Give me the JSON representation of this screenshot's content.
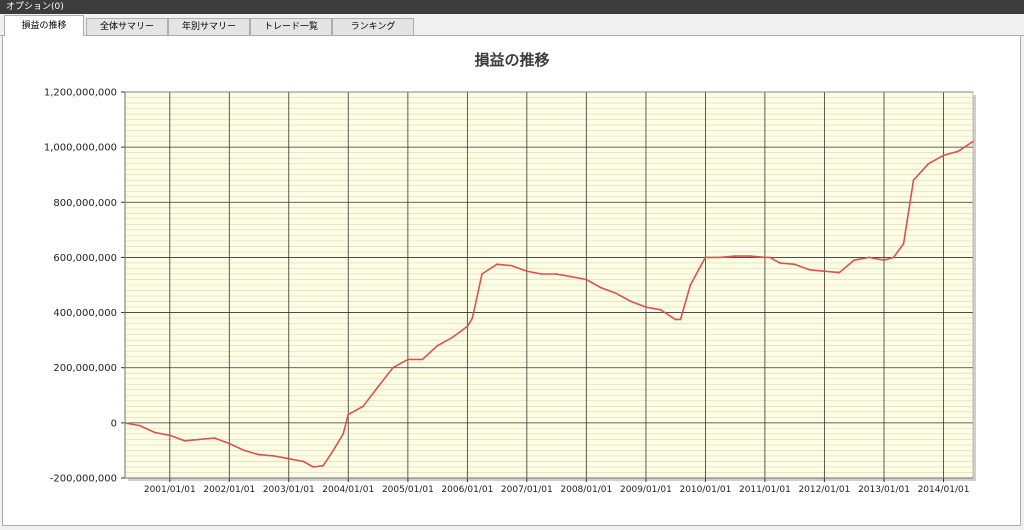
{
  "menu": {
    "options_label": "オプション(0)"
  },
  "tabs": [
    {
      "label": "損益の推移",
      "active": true
    },
    {
      "label": "全体サマリー",
      "active": false
    },
    {
      "label": "年別サマリー",
      "active": false
    },
    {
      "label": "トレード一覧",
      "active": false
    },
    {
      "label": "ランキング",
      "active": false
    }
  ],
  "colors": {
    "plot_background": "#fdfde6",
    "line": "#d9534f",
    "major_grid": "#333333",
    "minor_grid": "#d8d8b0"
  },
  "chart_data": {
    "type": "line",
    "title": "損益の推移",
    "xlabel": "",
    "ylabel": "",
    "xlim": [
      "2000/04/01",
      "2014/07/01"
    ],
    "ylim": [
      -200000000,
      1200000000
    ],
    "x_tick_labels": [
      "2001/01/01",
      "2002/01/01",
      "2003/01/01",
      "2004/01/01",
      "2005/01/01",
      "2006/01/01",
      "2007/01/01",
      "2008/01/01",
      "2009/01/01",
      "2010/01/01",
      "2011/01/01",
      "2012/01/01",
      "2013/01/01",
      "2014/01/01"
    ],
    "y_tick_labels": [
      "1,200,000,000",
      "1,000,000,000",
      "800,000,000",
      "600,000,000",
      "400,000,000",
      "200,000,000",
      "0",
      "-200,000,000"
    ],
    "y_tick_values": [
      1200000000,
      1000000000,
      800000000,
      600000000,
      400000000,
      200000000,
      0,
      -200000000
    ],
    "grid": true,
    "series": [
      {
        "x": [
          "2000/04/01",
          "2000/07/01",
          "2000/10/01",
          "2001/01/01",
          "2001/04/01",
          "2001/07/01",
          "2001/10/01",
          "2002/01/01",
          "2002/04/01",
          "2002/07/01",
          "2002/10/01",
          "2003/01/01",
          "2003/04/01",
          "2003/06/01",
          "2003/08/01",
          "2003/10/01",
          "2003/12/01",
          "2004/01/01",
          "2004/04/01",
          "2004/07/01",
          "2004/10/01",
          "2005/01/01",
          "2005/04/01",
          "2005/07/01",
          "2005/10/01",
          "2006/01/01",
          "2006/02/01",
          "2006/04/01",
          "2006/07/01",
          "2006/10/01",
          "2007/01/01",
          "2007/04/01",
          "2007/07/01",
          "2007/10/01",
          "2008/01/01",
          "2008/04/01",
          "2008/07/01",
          "2008/10/01",
          "2009/01/01",
          "2009/04/01",
          "2009/07/01",
          "2009/08/01",
          "2009/10/01",
          "2010/01/01",
          "2010/04/01",
          "2010/07/01",
          "2010/10/01",
          "2011/01/01",
          "2011/02/01",
          "2011/04/01",
          "2011/07/01",
          "2011/10/01",
          "2012/01/01",
          "2012/04/01",
          "2012/07/01",
          "2012/10/01",
          "2013/01/01",
          "2013/03/01",
          "2013/05/01",
          "2013/07/01",
          "2013/10/01",
          "2014/01/01",
          "2014/04/01",
          "2014/07/01"
        ],
        "values": [
          0,
          -10000000,
          -35000000,
          -45000000,
          -65000000,
          -60000000,
          -55000000,
          -75000000,
          -100000000,
          -115000000,
          -120000000,
          -130000000,
          -140000000,
          -160000000,
          -155000000,
          -100000000,
          -40000000,
          30000000,
          60000000,
          130000000,
          200000000,
          230000000,
          230000000,
          280000000,
          310000000,
          350000000,
          380000000,
          540000000,
          575000000,
          570000000,
          550000000,
          540000000,
          540000000,
          530000000,
          520000000,
          490000000,
          470000000,
          440000000,
          420000000,
          410000000,
          375000000,
          375000000,
          500000000,
          600000000,
          600000000,
          605000000,
          605000000,
          600000000,
          600000000,
          580000000,
          575000000,
          555000000,
          550000000,
          545000000,
          590000000,
          600000000,
          590000000,
          600000000,
          650000000,
          880000000,
          940000000,
          970000000,
          985000000,
          1020000000
        ]
      }
    ]
  }
}
